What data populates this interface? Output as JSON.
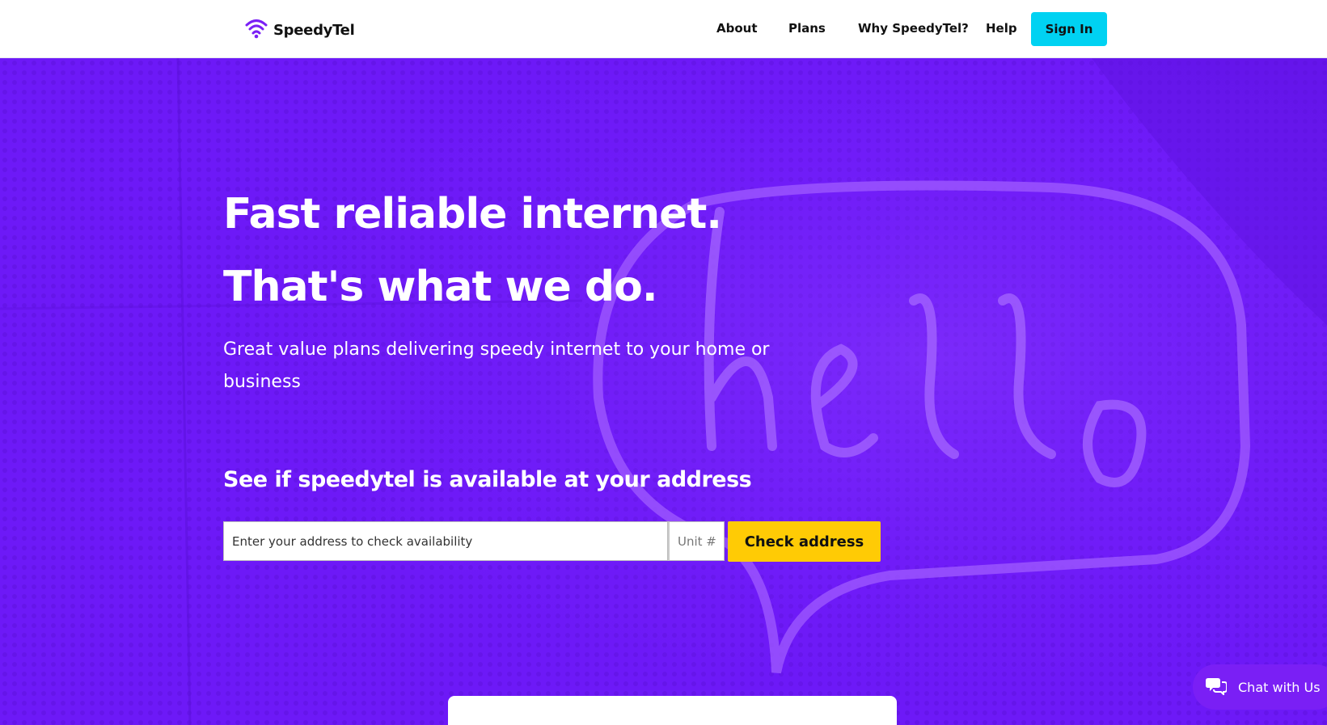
{
  "brand": {
    "name": "SpeedyTel"
  },
  "nav": {
    "items": [
      {
        "label": "About"
      },
      {
        "label": "Plans"
      },
      {
        "label": "Why SpeedyTel?"
      },
      {
        "label": "Help"
      }
    ],
    "sign_in": "Sign In"
  },
  "hero": {
    "headline_1": "Fast reliable internet.",
    "headline_2": "That's what we do.",
    "subtitle": "Great value plans delivering speedy internet to your home or business",
    "availability_heading": "See if speedytel is available at your address",
    "address_placeholder": "Enter your address to check availability",
    "unit_placeholder": "Unit #",
    "check_button": "Check address",
    "background_image": "neon hello sign"
  },
  "chat": {
    "label": "Chat with Us",
    "icon": "chat-bubbles-icon"
  },
  "colors": {
    "hero_bg": "#6d19f7",
    "sign_in_bg": "#00d2f2",
    "cta_bg": "#ffcb05",
    "logo_purple": "#7a1ff5"
  }
}
